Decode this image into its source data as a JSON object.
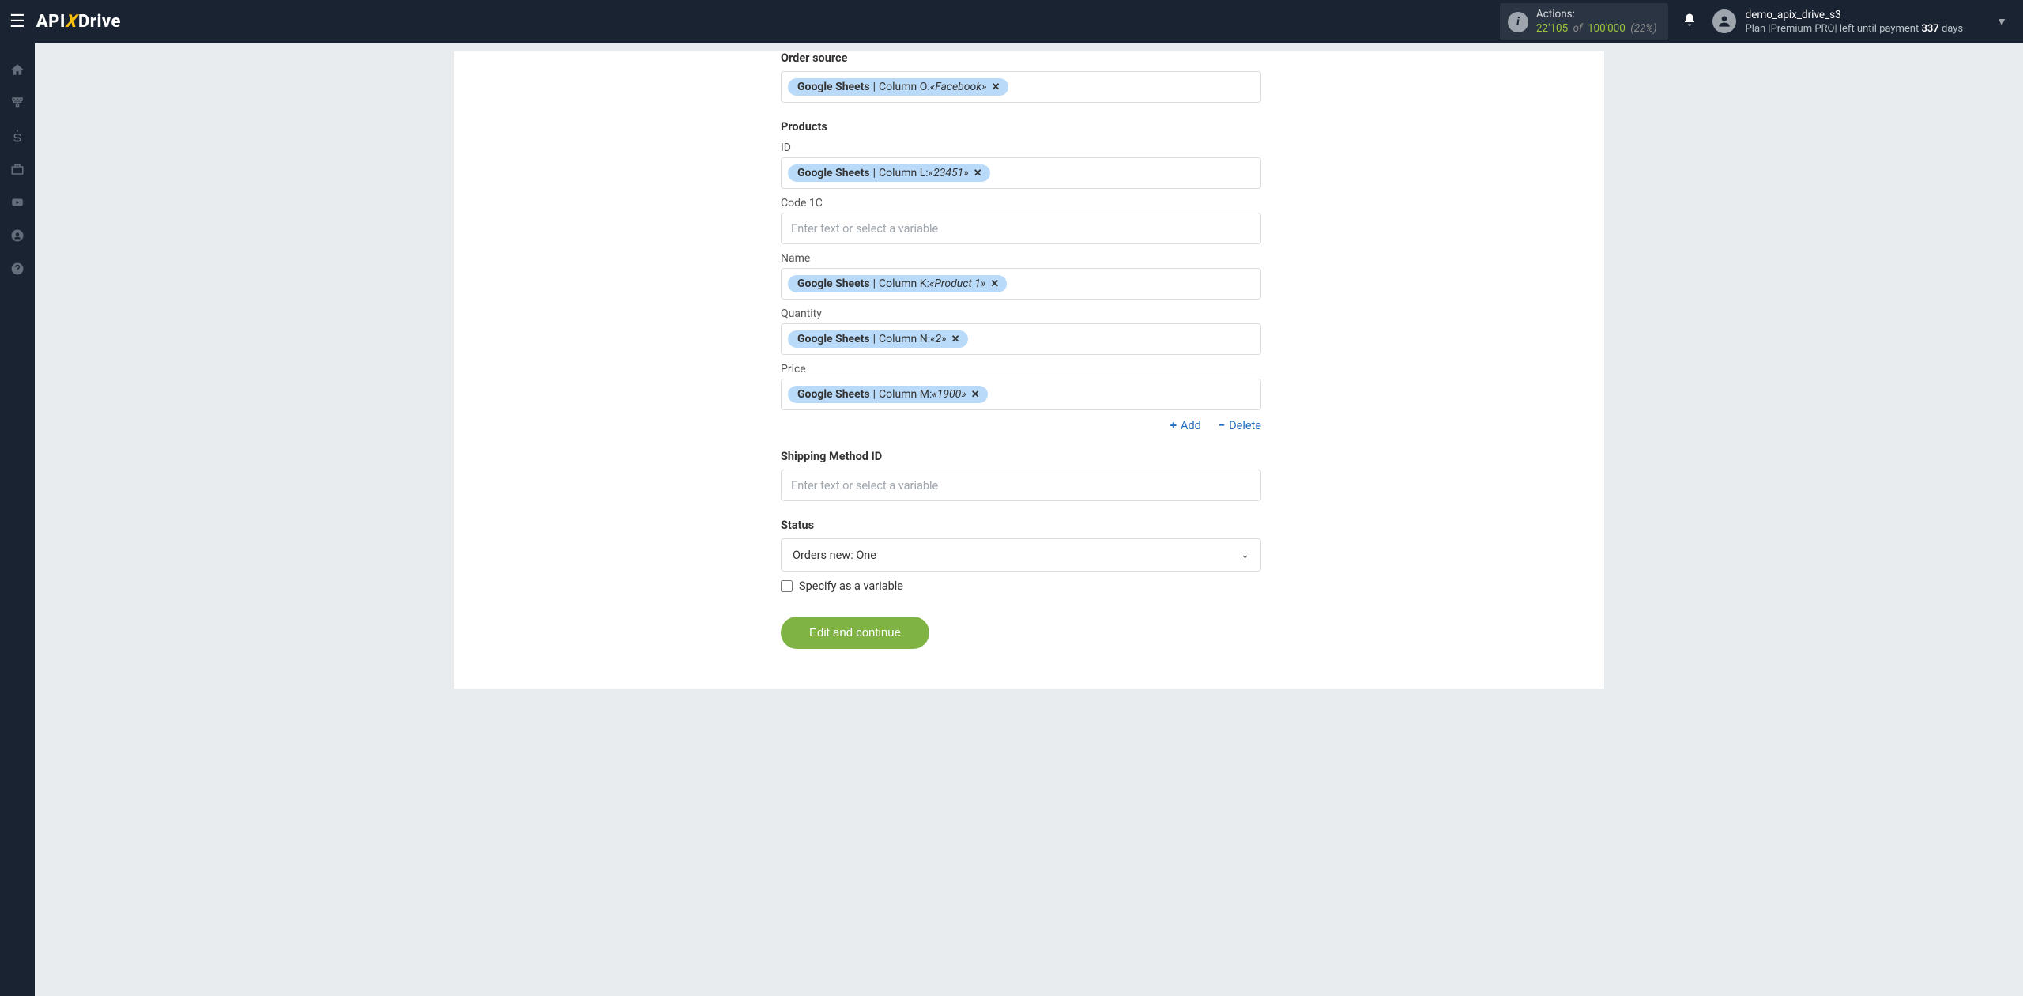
{
  "header": {
    "logo_pre": "API",
    "logo_x": "X",
    "logo_post": "Drive",
    "actions_label": "Actions:",
    "actions_used": "22'105",
    "actions_of": "of",
    "actions_total": "100'000",
    "actions_pct": "(22%)",
    "username": "demo_apix_drive_s3",
    "plan_pre": "Plan |Premium PRO| left until payment ",
    "plan_days": "337",
    "plan_suf": " days"
  },
  "form": {
    "order_source": {
      "label": "Order source",
      "pill": {
        "src": "Google Sheets",
        "col": "Column O: ",
        "val": "«Facebook»"
      }
    },
    "products": {
      "title": "Products",
      "id": {
        "label": "ID",
        "pill": {
          "src": "Google Sheets",
          "col": "Column L: ",
          "val": "«23451»"
        }
      },
      "code1c": {
        "label": "Code 1C",
        "placeholder": "Enter text or select a variable"
      },
      "name": {
        "label": "Name",
        "pill": {
          "src": "Google Sheets",
          "col": "Column K: ",
          "val": "«Product 1»"
        }
      },
      "qty": {
        "label": "Quantity",
        "pill": {
          "src": "Google Sheets",
          "col": "Column N: ",
          "val": "«2»"
        }
      },
      "price": {
        "label": "Price",
        "pill": {
          "src": "Google Sheets",
          "col": "Column M: ",
          "val": "«1900»"
        }
      },
      "add": "Add",
      "delete": "Delete"
    },
    "shipping": {
      "label": "Shipping Method ID",
      "placeholder": "Enter text or select a variable"
    },
    "status": {
      "label": "Status",
      "value": "Orders new: One",
      "chk": "Specify as a variable"
    },
    "submit": "Edit and continue"
  }
}
